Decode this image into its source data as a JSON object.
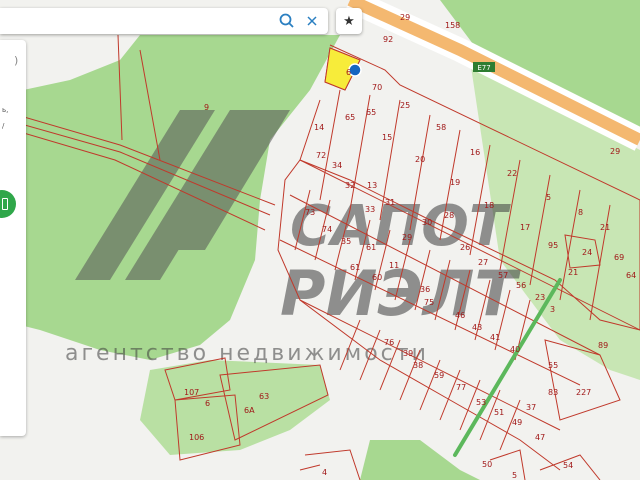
{
  "search": {
    "placeholder": "",
    "value": ""
  },
  "icons": {
    "search": "search-icon",
    "clear": "close-icon",
    "favorite": "star-icon"
  },
  "favorite_glyph": "★",
  "side_panel": {
    "frag_top": ")",
    "frag_1": "ь,",
    "frag_2": "/"
  },
  "roads": {
    "e77": "E77",
    "r29a": "29",
    "r158": "158",
    "r92": "92",
    "r29b": "29"
  },
  "watermark": {
    "line1": "САПОТ",
    "line2": "РИЭЛТ",
    "tagline": "агентство недвижимости"
  },
  "plots": {
    "p6": "6",
    "p70": "70",
    "p25": "25",
    "p58": "58",
    "p9": "9",
    "p14": "14",
    "p65a": "65",
    "p65b": "65",
    "p15": "15",
    "p20": "20",
    "p16": "16",
    "p22": "22",
    "p72": "72",
    "p34": "34",
    "p32": "32",
    "p13": "13",
    "p19": "19",
    "p5": "5",
    "p8": "8",
    "p21a": "21",
    "p73": "73",
    "p33": "33",
    "p31": "31",
    "p30": "30",
    "p28": "28",
    "p18": "18",
    "p17": "17",
    "p74": "74",
    "p35": "35",
    "p61a": "61",
    "p29": "29",
    "p26": "26",
    "p95": "95",
    "p24": "24",
    "p69": "69",
    "p61b": "61",
    "p60": "60",
    "p11": "11",
    "p27": "27",
    "p57": "57",
    "p56": "56",
    "p21b": "21",
    "p64": "64",
    "p36": "36",
    "p75": "75",
    "p46": "46",
    "p43": "43",
    "p41": "41",
    "p23": "23",
    "p3": "3",
    "p76": "76",
    "p39": "39",
    "p40": "40",
    "p89": "89",
    "p38": "38",
    "p59": "59",
    "p55": "55",
    "p107": "107",
    "p63": "63",
    "p6b": "6",
    "p6a": "6А",
    "p106": "106",
    "p77": "77",
    "p83": "83",
    "p227": "227",
    "p53": "53",
    "p51": "51",
    "p49": "49",
    "p37": "37",
    "p47": "47",
    "p50": "50",
    "p54": "54",
    "p4": "4",
    "p5b": "5"
  }
}
